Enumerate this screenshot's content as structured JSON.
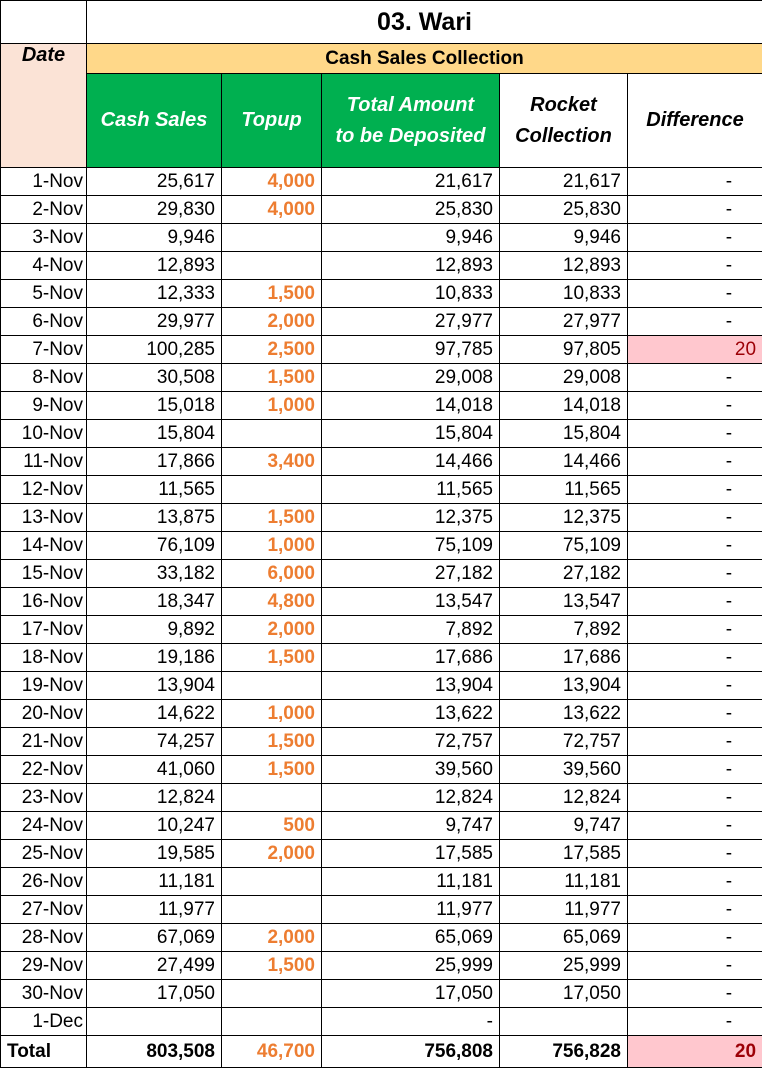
{
  "sheet": {
    "title": "03. Wari",
    "section": "Cash Sales Collection",
    "headers": {
      "date": "Date",
      "cash_sales": "Cash Sales",
      "topup": "Topup",
      "total_amount_line1": "Total Amount",
      "total_amount_line2": "to be Deposited",
      "rocket_line1": "Rocket",
      "rocket_line2": "Collection",
      "difference": "Difference"
    },
    "rows": [
      {
        "date": "1-Nov",
        "cash": "25,617",
        "topup": "4,000",
        "total": "21,617",
        "rocket": "21,617",
        "diff": "-"
      },
      {
        "date": "2-Nov",
        "cash": "29,830",
        "topup": "4,000",
        "total": "25,830",
        "rocket": "25,830",
        "diff": "-"
      },
      {
        "date": "3-Nov",
        "cash": "9,946",
        "topup": "",
        "total": "9,946",
        "rocket": "9,946",
        "diff": "-"
      },
      {
        "date": "4-Nov",
        "cash": "12,893",
        "topup": "",
        "total": "12,893",
        "rocket": "12,893",
        "diff": "-"
      },
      {
        "date": "5-Nov",
        "cash": "12,333",
        "topup": "1,500",
        "total": "10,833",
        "rocket": "10,833",
        "diff": "-"
      },
      {
        "date": "6-Nov",
        "cash": "29,977",
        "topup": "2,000",
        "total": "27,977",
        "rocket": "27,977",
        "diff": "-"
      },
      {
        "date": "7-Nov",
        "cash": "100,285",
        "topup": "2,500",
        "total": "97,785",
        "rocket": "97,805",
        "diff": "20",
        "highlight": true
      },
      {
        "date": "8-Nov",
        "cash": "30,508",
        "topup": "1,500",
        "total": "29,008",
        "rocket": "29,008",
        "diff": "-"
      },
      {
        "date": "9-Nov",
        "cash": "15,018",
        "topup": "1,000",
        "total": "14,018",
        "rocket": "14,018",
        "diff": "-"
      },
      {
        "date": "10-Nov",
        "cash": "15,804",
        "topup": "",
        "total": "15,804",
        "rocket": "15,804",
        "diff": "-"
      },
      {
        "date": "11-Nov",
        "cash": "17,866",
        "topup": "3,400",
        "total": "14,466",
        "rocket": "14,466",
        "diff": "-"
      },
      {
        "date": "12-Nov",
        "cash": "11,565",
        "topup": "",
        "total": "11,565",
        "rocket": "11,565",
        "diff": "-"
      },
      {
        "date": "13-Nov",
        "cash": "13,875",
        "topup": "1,500",
        "total": "12,375",
        "rocket": "12,375",
        "diff": "-"
      },
      {
        "date": "14-Nov",
        "cash": "76,109",
        "topup": "1,000",
        "total": "75,109",
        "rocket": "75,109",
        "diff": "-"
      },
      {
        "date": "15-Nov",
        "cash": "33,182",
        "topup": "6,000",
        "total": "27,182",
        "rocket": "27,182",
        "diff": "-"
      },
      {
        "date": "16-Nov",
        "cash": "18,347",
        "topup": "4,800",
        "total": "13,547",
        "rocket": "13,547",
        "diff": "-"
      },
      {
        "date": "17-Nov",
        "cash": "9,892",
        "topup": "2,000",
        "total": "7,892",
        "rocket": "7,892",
        "diff": "-"
      },
      {
        "date": "18-Nov",
        "cash": "19,186",
        "topup": "1,500",
        "total": "17,686",
        "rocket": "17,686",
        "diff": "-"
      },
      {
        "date": "19-Nov",
        "cash": "13,904",
        "topup": "",
        "total": "13,904",
        "rocket": "13,904",
        "diff": "-"
      },
      {
        "date": "20-Nov",
        "cash": "14,622",
        "topup": "1,000",
        "total": "13,622",
        "rocket": "13,622",
        "diff": "-"
      },
      {
        "date": "21-Nov",
        "cash": "74,257",
        "topup": "1,500",
        "total": "72,757",
        "rocket": "72,757",
        "diff": "-"
      },
      {
        "date": "22-Nov",
        "cash": "41,060",
        "topup": "1,500",
        "total": "39,560",
        "rocket": "39,560",
        "diff": "-"
      },
      {
        "date": "23-Nov",
        "cash": "12,824",
        "topup": "",
        "total": "12,824",
        "rocket": "12,824",
        "diff": "-"
      },
      {
        "date": "24-Nov",
        "cash": "10,247",
        "topup": "500",
        "total": "9,747",
        "rocket": "9,747",
        "diff": "-"
      },
      {
        "date": "25-Nov",
        "cash": "19,585",
        "topup": "2,000",
        "total": "17,585",
        "rocket": "17,585",
        "diff": "-"
      },
      {
        "date": "26-Nov",
        "cash": "11,181",
        "topup": "",
        "total": "11,181",
        "rocket": "11,181",
        "diff": "-"
      },
      {
        "date": "27-Nov",
        "cash": "11,977",
        "topup": "",
        "total": "11,977",
        "rocket": "11,977",
        "diff": "-"
      },
      {
        "date": "28-Nov",
        "cash": "67,069",
        "topup": "2,000",
        "total": "65,069",
        "rocket": "65,069",
        "diff": "-"
      },
      {
        "date": "29-Nov",
        "cash": "27,499",
        "topup": "1,500",
        "total": "25,999",
        "rocket": "25,999",
        "diff": "-"
      },
      {
        "date": "30-Nov",
        "cash": "17,050",
        "topup": "",
        "total": "17,050",
        "rocket": "17,050",
        "diff": "-"
      },
      {
        "date": "1-Dec",
        "cash": "",
        "topup": "",
        "total": "-",
        "rocket": "",
        "diff": "-"
      }
    ],
    "totals": {
      "label": "Total",
      "cash": "803,508",
      "topup": "46,700",
      "total": "756,808",
      "rocket": "756,828",
      "diff": "20"
    },
    "colors": {
      "section_bg": "#ffd889",
      "date_header_bg": "#fbe3d6",
      "green_header_bg": "#00b050",
      "topup_text": "#ed7d31",
      "highlight_bg": "#ffc7ce",
      "highlight_text": "#9c0006"
    }
  }
}
